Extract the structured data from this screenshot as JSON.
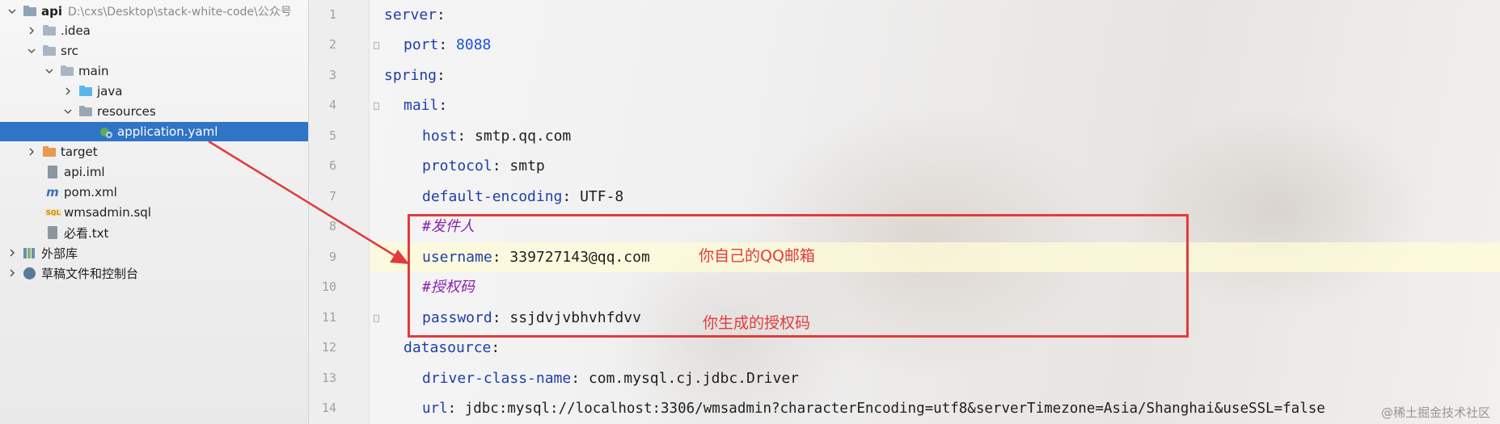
{
  "project_tree": {
    "items": [
      {
        "label": "api",
        "extra": "D:\\cxs\\Desktop\\stack-white-code\\公众号",
        "icon": "module-icon",
        "expanded": true
      },
      {
        "label": ".idea",
        "icon": "folder-icon",
        "expanded": false
      },
      {
        "label": "src",
        "icon": "folder-icon",
        "expanded": true
      },
      {
        "label": "main",
        "icon": "folder-icon",
        "expanded": true
      },
      {
        "label": "java",
        "icon": "source-folder-icon",
        "expanded": false
      },
      {
        "label": "resources",
        "icon": "resources-folder-icon",
        "expanded": true
      },
      {
        "label": "application.yaml",
        "icon": "yaml-file-icon",
        "selected": true
      },
      {
        "label": "target",
        "icon": "excluded-folder-icon",
        "expanded": false
      },
      {
        "label": "api.iml",
        "icon": "iml-file-icon"
      },
      {
        "label": "pom.xml",
        "icon": "maven-icon"
      },
      {
        "label": "wmsadmin.sql",
        "icon": "sql-file-icon"
      },
      {
        "label": "必看.txt",
        "icon": "text-file-icon"
      },
      {
        "label": "外部库",
        "icon": "library-icon",
        "expanded": false
      },
      {
        "label": "草稿文件和控制台",
        "icon": "scratch-icon",
        "expanded": false
      }
    ]
  },
  "editor": {
    "line_numbers": [
      "1",
      "2",
      "3",
      "4",
      "5",
      "6",
      "7",
      "8",
      "9",
      "10",
      "11",
      "12",
      "13",
      "14"
    ],
    "lines": [
      {
        "key": "server",
        "sep": ":",
        "value": ""
      },
      {
        "key": "port",
        "sep": ": ",
        "value": "8088"
      },
      {
        "key": "spring",
        "sep": ":",
        "value": ""
      },
      {
        "key": "mail",
        "sep": ":",
        "value": ""
      },
      {
        "key": "host",
        "sep": ": ",
        "value": "smtp.qq.com"
      },
      {
        "key": "protocol",
        "sep": ": ",
        "value": "smtp"
      },
      {
        "key": "default-encoding",
        "sep": ": ",
        "value": "UTF-8"
      },
      {
        "comment": "#发件人"
      },
      {
        "key": "username",
        "sep": ": ",
        "value": "339727143@qq.com"
      },
      {
        "comment": "#授权码"
      },
      {
        "key": "password",
        "sep": ": ",
        "value": "ssjdvjvbhvhfdvv"
      },
      {
        "key": "datasource",
        "sep": ":",
        "value": ""
      },
      {
        "key": "driver-class-name",
        "sep": ": ",
        "value": "com.mysql.cj.jdbc.Driver"
      },
      {
        "key": "url",
        "sep": ": ",
        "value": "jdbc:mysql://localhost:3306/wmsadmin?characterEncoding=utf8&serverTimezone=Asia/Shanghai&useSSL=false"
      }
    ]
  },
  "annotations": {
    "username_note": "你自己的QQ邮箱",
    "password_note": "你生成的授权码"
  },
  "watermark": "@稀土掘金技术社区",
  "colors": {
    "selection": "#2f74c7",
    "key": "#1e3fa8",
    "number": "#1e4fd8",
    "comment": "#8c1fb0",
    "annotation": "#e23b3b"
  }
}
